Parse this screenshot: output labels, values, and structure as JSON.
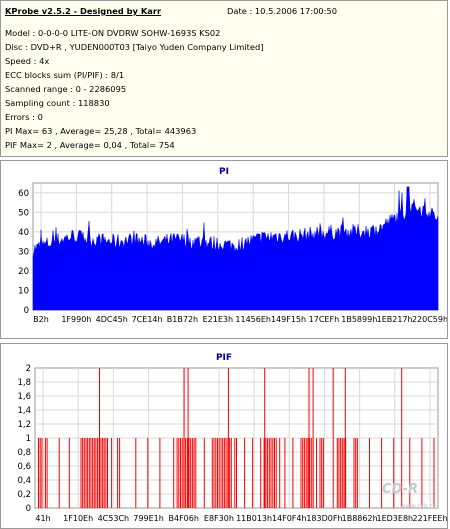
{
  "header": {
    "title": "KProbe v2.5.2 - Designed by Karr",
    "date": "Date : 10.5.2006 17:00:50",
    "lines": [
      "Model : 0-0-0-0 LITE-ON DVDRW SOHW-1693S KS02",
      "Disc : DVD+R , YUDEN000T03 [Taiyo Yuden Company Limited]",
      "Speed : 4x",
      "ECC blocks sum (PI/PIF) : 8/1",
      "Scanned range : 0 - 2286095",
      "Sampling count : 118830",
      "Errors : 0",
      "PI Max= 63 , Average= 25,28 , Total= 443963",
      "PIF Max= 2 , Average= 0,04 , Total= 754"
    ]
  },
  "colors": {
    "pi": "#0000ff",
    "pif": "#ff0000",
    "grid": "#d8d8d8",
    "frame": "#9a9a9a"
  },
  "chart_data": [
    {
      "type": "area",
      "title": "PI",
      "ylim": [
        0,
        65
      ],
      "yticks": [
        0,
        10,
        20,
        30,
        40,
        50,
        60
      ],
      "grid": true,
      "x_tick_labels": [
        "B2h",
        "1F990h",
        "4DC45h",
        "7CE14h",
        "B1B72h",
        "E21E3h",
        "11456Eh",
        "149F15h",
        "17CEFh",
        "1B5899h",
        "1EB217h",
        "220C59h"
      ],
      "profile": [
        [
          0,
          31
        ],
        [
          0.05,
          35
        ],
        [
          0.1,
          38
        ],
        [
          0.15,
          36
        ],
        [
          0.2,
          35
        ],
        [
          0.25,
          36
        ],
        [
          0.3,
          34
        ],
        [
          0.35,
          36
        ],
        [
          0.4,
          35
        ],
        [
          0.45,
          34
        ],
        [
          0.5,
          33
        ],
        [
          0.55,
          36
        ],
        [
          0.6,
          38
        ],
        [
          0.65,
          38
        ],
        [
          0.7,
          39
        ],
        [
          0.75,
          40
        ],
        [
          0.8,
          40
        ],
        [
          0.85,
          41
        ],
        [
          0.88,
          45
        ],
        [
          0.91,
          49
        ],
        [
          0.94,
          53
        ],
        [
          0.97,
          51
        ],
        [
          1,
          47
        ]
      ],
      "max": 63
    },
    {
      "type": "bar",
      "title": "PIF",
      "ylim": [
        0,
        2
      ],
      "yticks": [
        0,
        0.2,
        0.4,
        0.6,
        0.8,
        1,
        1.2,
        1.4,
        1.6,
        1.8,
        2
      ],
      "ytick_labels": [
        "0",
        "0,2",
        "0,4",
        "0,6",
        "0,8",
        "1",
        "1,2",
        "1,4",
        "1,6",
        "1,8",
        "2"
      ],
      "grid": true,
      "x_tick_labels": [
        "41h",
        "1F10Eh",
        "4C53Ch",
        "799E1h",
        "B4F06h",
        "E8F30h",
        "11B013h",
        "14F0F4h",
        "183D0Fh",
        "1B8862h",
        "1ED3E8h",
        "221FEEh"
      ],
      "spikes_value_2": [
        0.16,
        0.37,
        0.38,
        0.48,
        0.57,
        0.68,
        0.69,
        0.74,
        0.77,
        0.91
      ],
      "dense_value_1_regions": [
        [
          0.0,
          0.03
        ],
        [
          0.11,
          0.18
        ],
        [
          0.19,
          0.21
        ],
        [
          0.34,
          0.42
        ],
        [
          0.44,
          0.5
        ],
        [
          0.56,
          0.62
        ],
        [
          0.66,
          0.72
        ],
        [
          0.75,
          0.8
        ]
      ],
      "sparse_value_1": [
        0.06,
        0.085,
        0.25,
        0.28,
        0.31,
        0.52,
        0.54,
        0.64,
        0.83,
        0.86,
        0.89,
        0.93,
        0.96,
        0.99
      ]
    }
  ],
  "watermark": {
    "text": "CD-R",
    "url": "www.cdr.cz"
  }
}
